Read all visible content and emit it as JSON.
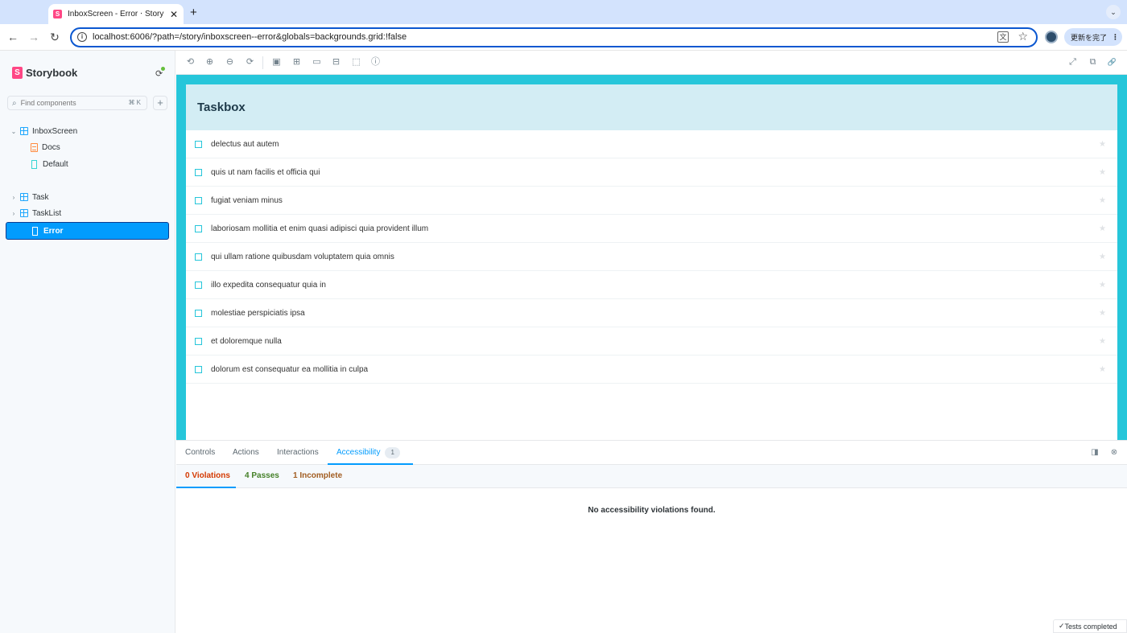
{
  "browser": {
    "tab_title": "InboxScreen - Error ⋅ Storybook",
    "tab_favicon": "S",
    "close_glyph": "✕",
    "new_tab_glyph": "+",
    "tab_menu_glyph": "⌄",
    "back_glyph": "←",
    "forward_glyph": "→",
    "reload_glyph": "↻",
    "url": "localhost:6006/?path=/story/inboxscreen--error&globals=backgrounds.grid:!false",
    "info_glyph": "i",
    "translate_glyph": "文",
    "bookmark_glyph": "☆",
    "update_label": "更新を完了",
    "update_menu_glyph": "⋮"
  },
  "sidebar": {
    "brand_logo": "S",
    "brand_name": "Storybook",
    "status_glyph": "⟳",
    "search_icon": "⌕",
    "search_placeholder": "Find components",
    "search_shortcut": "⌘ K",
    "add_glyph": "+",
    "collapse_glyph": "⌄",
    "expand_glyph": "›",
    "tree": {
      "group": "InboxScreen",
      "docs": "Docs",
      "default": "Default",
      "error": "Error",
      "task": "Task",
      "tasklist": "TaskList"
    }
  },
  "preview_toolbar": {
    "left_icons": [
      "remount-icon",
      "zoom-in-icon",
      "zoom-out-icon",
      "zoom-reset-icon",
      "background-icon",
      "grid-icon",
      "viewport-icon",
      "measure-icon",
      "outline-icon",
      "accessibility-icon"
    ],
    "glyphs": {
      "remount": "⟲",
      "zoom_in": "⊕",
      "zoom_out": "⊖",
      "zoom_reset": "⟳",
      "background": "▣",
      "grid": "⊞",
      "viewport": "▭",
      "measure": "⊟",
      "outline": "⬚",
      "accessibility": "ⓘ",
      "fullscreen": "⤢",
      "new_tab": "⧉",
      "link": "🔗"
    }
  },
  "taskbox": {
    "title": "Taskbox",
    "star_glyph": "★",
    "tasks": [
      "delectus aut autem",
      "quis ut nam facilis et officia qui",
      "fugiat veniam minus",
      "laboriosam mollitia et enim quasi adipisci quia provident illum",
      "qui ullam ratione quibusdam voluptatem quia omnis",
      "illo expedita consequatur quia in",
      "molestiae perspiciatis ipsa",
      "et doloremque nulla",
      "dolorum est consequatur ea mollitia in culpa"
    ]
  },
  "panel": {
    "tabs": {
      "controls": "Controls",
      "actions": "Actions",
      "interactions": "Interactions",
      "accessibility": "Accessibility",
      "accessibility_badge": "1"
    },
    "dock_glyph": "◨",
    "close_glyph": "⊗",
    "subtabs": {
      "violations": "0 Violations",
      "passes": "4 Passes",
      "incomplete": "1 Incomplete"
    },
    "colors": {
      "violations": "#d43900",
      "passes": "#448028",
      "incomplete": "#a15c20",
      "accent": "#029cfd"
    },
    "empty_message": "No accessibility violations found.",
    "tests_status": "Tests completed",
    "tests_check": "✓"
  }
}
